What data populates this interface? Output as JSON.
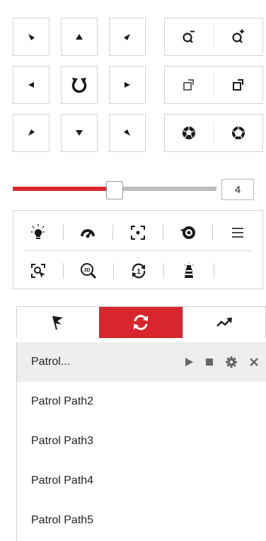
{
  "ptz": {
    "direction_buttons": [
      {
        "name": "pan-up-left-button",
        "icon": "triangle-down-right"
      },
      {
        "name": "pan-up-button",
        "icon": "triangle-up"
      },
      {
        "name": "pan-up-right-button",
        "icon": "triangle-down-left"
      },
      {
        "name": "pan-left-button",
        "icon": "triangle-left"
      },
      {
        "name": "auto-pan-button",
        "icon": "rotate-icon"
      },
      {
        "name": "pan-right-button",
        "icon": "triangle-right"
      },
      {
        "name": "pan-down-left-button",
        "icon": "triangle-up-right"
      },
      {
        "name": "pan-down-button",
        "icon": "triangle-down"
      },
      {
        "name": "pan-down-right-button",
        "icon": "triangle-up-left"
      }
    ],
    "lens_buttons": [
      "zoom-out-icon",
      "zoom-in-icon",
      "focus-near-icon",
      "focus-far-icon",
      "iris-close-icon",
      "iris-open-icon"
    ]
  },
  "speed": {
    "value": "4",
    "level_fraction": 0.5
  },
  "toolbar": {
    "row1": [
      "light-icon",
      "wiper-icon",
      "auxiliary-focus-icon",
      "lens-initialization-icon",
      "menu-icon"
    ],
    "row2": [
      "manual-tracking-icon",
      "3d-zoom-icon",
      "park-icon",
      "manual-lamp-icon"
    ]
  },
  "tabs": [
    {
      "icon": "flag-icon",
      "active": false
    },
    {
      "icon": "patrol-icon",
      "active": true
    },
    {
      "icon": "pattern-icon",
      "active": false
    }
  ],
  "patrol": {
    "items": [
      {
        "label": "Patrol...",
        "selected": true
      },
      {
        "label": "Patrol Path2"
      },
      {
        "label": "Patrol Path3"
      },
      {
        "label": "Patrol Path4"
      },
      {
        "label": "Patrol Path5"
      }
    ]
  },
  "colors": {
    "accent": "#d7262e",
    "icon": "#1a1a1a",
    "border": "#d3d3d3"
  }
}
